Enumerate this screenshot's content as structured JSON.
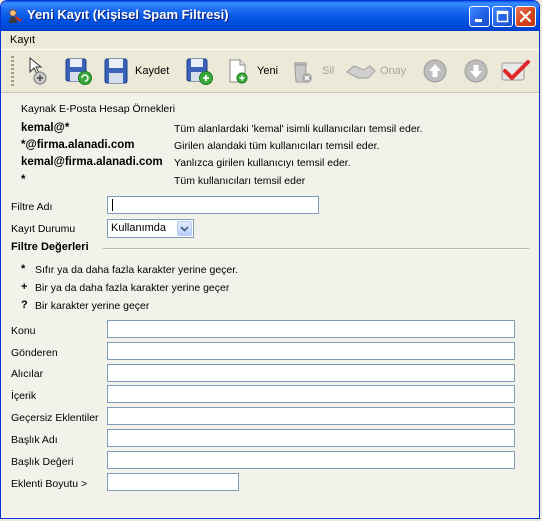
{
  "window": {
    "title": "Yeni Kayıt (Kişisel Spam Filtresi)",
    "buttons": {
      "minimize": "_",
      "maximize": "□",
      "close": "×"
    }
  },
  "menu": {
    "items": [
      "Kayıt"
    ]
  },
  "toolbar": {
    "save_label": "Kaydet",
    "new_label": "Yeni",
    "delete_label": "Sil",
    "approve_label": "Onay"
  },
  "examples": {
    "heading": "Kaynak E-Posta Hesap Örnekleri",
    "rows": [
      {
        "pattern": "kemal@*",
        "desc": "Tüm alanlardaki 'kemal' isimli kullanıcıları temsil eder."
      },
      {
        "pattern": "*@firma.alanadi.com",
        "desc": "Girilen alandaki tüm kullanıcıları temsil eder."
      },
      {
        "pattern": "kemal@firma.alanadi.com",
        "desc": "Yanlızca girilen kullanıcıyı temsil eder."
      },
      {
        "pattern": "*",
        "desc": "Tüm kullanıcıları temsil eder"
      }
    ]
  },
  "form": {
    "filter_name_label": "Filtre Adı",
    "filter_name_value": "",
    "status_label": "Kayıt Durumu",
    "status_value": "Kullanımda"
  },
  "filter_values": {
    "heading": "Filtre Değerleri",
    "legend": [
      {
        "symbol": "*",
        "text": "Sıfır ya da daha fazla karakter yerine geçer."
      },
      {
        "symbol": "+",
        "text": "Bir ya da daha fazla karakter yerine geçer"
      },
      {
        "symbol": "?",
        "text": "Bir karakter yerine geçer"
      }
    ],
    "fields": [
      {
        "label": "Konu",
        "value": ""
      },
      {
        "label": "Gönderen",
        "value": ""
      },
      {
        "label": "Alıcılar",
        "value": ""
      },
      {
        "label": "İçerik",
        "value": ""
      },
      {
        "label": "Geçersiz Eklentiler",
        "value": ""
      },
      {
        "label": "Başlık Adı",
        "value": ""
      },
      {
        "label": "Başlık Değeri",
        "value": ""
      }
    ],
    "attachment_size_label": "Eklenti Boyutu >",
    "attachment_size_value": ""
  }
}
